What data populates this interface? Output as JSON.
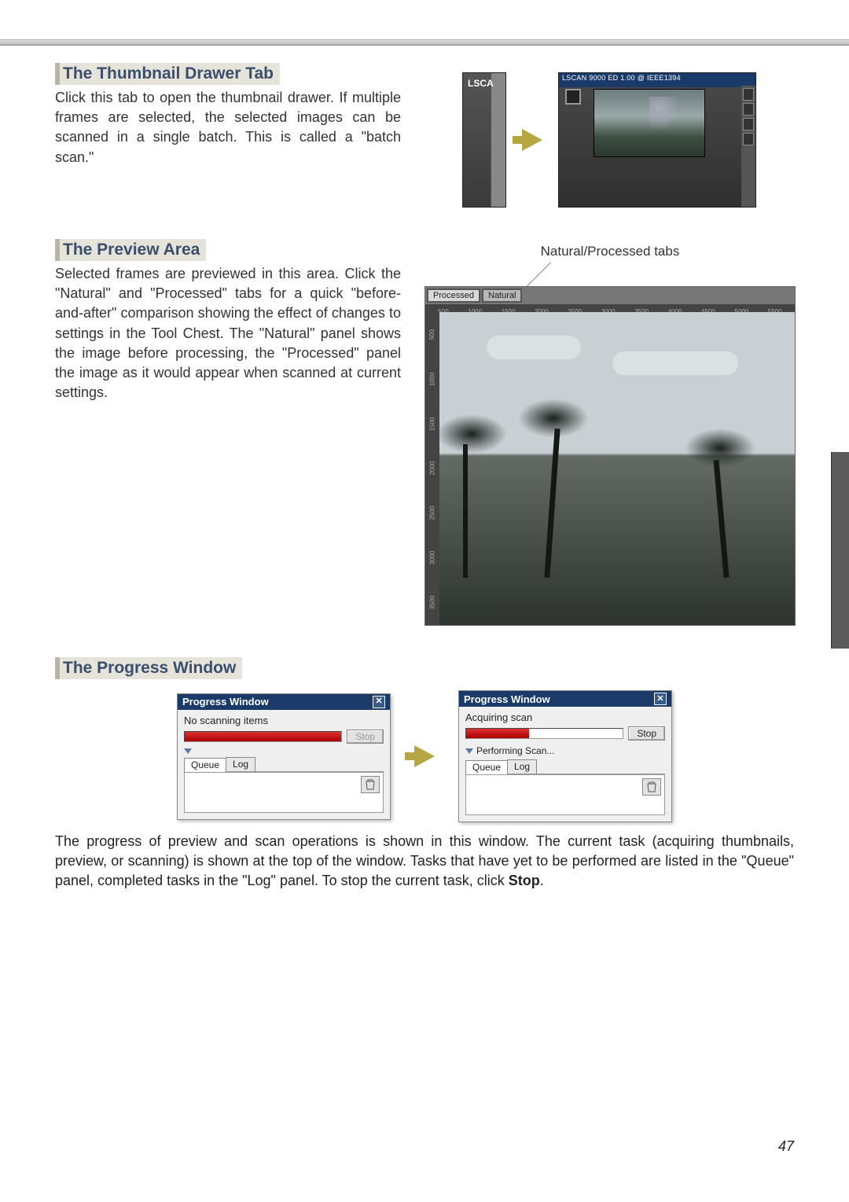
{
  "section1": {
    "heading": "The Thumbnail Drawer Tab",
    "body": "Click this tab to open the thumbnail drawer. If multiple frames are selected, the selected images can be scanned in a single batch. This is called a \"batch scan.\"",
    "drawer_closed_label": "LSCA",
    "drawer_open_title": "LSCAN 9000 ED 1.00 @ IEEE1394"
  },
  "section2": {
    "heading": "The Preview Area",
    "body": "Selected frames are previewed in this area. Click the \"Natural\" and \"Processed\" tabs for a quick \"before-and-after\" comparison showing the effect of changes to settings in the Tool Chest. The \"Natural\" panel shows the image before processing, the \"Processed\" panel the image as it would appear when scanned at current settings.",
    "tabs_caption": "Natural/Processed tabs",
    "tab_processed": "Processed",
    "tab_natural": "Natural",
    "ruler_h": [
      "500",
      "1000",
      "1500",
      "2000",
      "2500",
      "3000",
      "3500",
      "4000",
      "4500",
      "5000",
      "5500"
    ],
    "ruler_v": [
      "500",
      "1000",
      "1500",
      "2000",
      "2500",
      "3000",
      "3500"
    ]
  },
  "section3": {
    "heading": "The Progress Window",
    "win_title": "Progress Window",
    "left": {
      "status": "No scanning items",
      "stop": "Stop",
      "tab_queue": "Queue",
      "tab_log": "Log"
    },
    "right": {
      "status": "Acquiring scan",
      "stop": "Stop",
      "disclosure": "Performing Scan...",
      "tab_queue": "Queue",
      "tab_log": "Log"
    },
    "body_pre": "The progress of preview and scan operations is shown in this window. The current task (acquiring thumbnails, preview, or scanning) is shown at the top of the window. Tasks that have yet to be performed are listed in the \"Queue\" panel, completed tasks in the \"Log\" panel. To stop the current task, click ",
    "body_bold": "Stop",
    "body_post": "."
  },
  "page_number": "47"
}
